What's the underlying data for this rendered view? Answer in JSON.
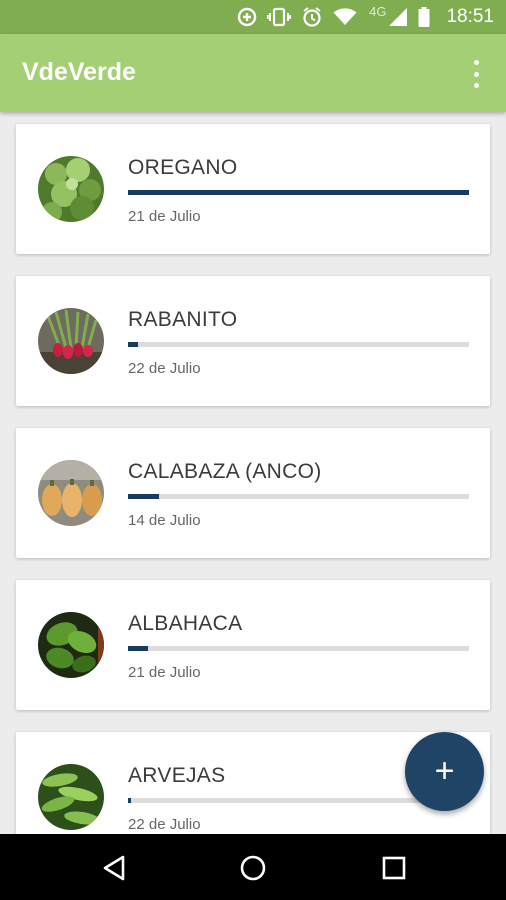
{
  "status_bar": {
    "time": "18:51",
    "network": "4G",
    "icons": [
      "data-saver-icon",
      "vibrate-icon",
      "alarm-icon",
      "wifi-icon",
      "cellular-signal-icon",
      "battery-icon"
    ]
  },
  "app_bar": {
    "title": "VdeVerde",
    "menu_icon": "overflow-menu-icon"
  },
  "plants": [
    {
      "name": "OREGANO",
      "date": "21 de Julio",
      "progress": 1.0,
      "image": "oregano"
    },
    {
      "name": "RABANITO",
      "date": "22 de Julio",
      "progress": 0.03,
      "image": "radish"
    },
    {
      "name": "CALABAZA (ANCO)",
      "date": "14 de Julio",
      "progress": 0.09,
      "image": "squash"
    },
    {
      "name": "ALBAHACA",
      "date": "21 de Julio",
      "progress": 0.06,
      "image": "basil"
    },
    {
      "name": "ARVEJAS",
      "date": "22 de Julio",
      "progress": 0.01,
      "image": "peas"
    }
  ],
  "fab": {
    "label": "+",
    "icon": "add-icon"
  },
  "nav_bar": {
    "icons": [
      "back-icon",
      "home-icon",
      "recents-icon"
    ]
  },
  "colors": {
    "status_bar": "#7fad4f",
    "app_bar": "#a4cf74",
    "progress_fill": "#173c5e",
    "progress_track": "#dcdcdc",
    "fab": "#1f4466",
    "background": "#ececec"
  }
}
